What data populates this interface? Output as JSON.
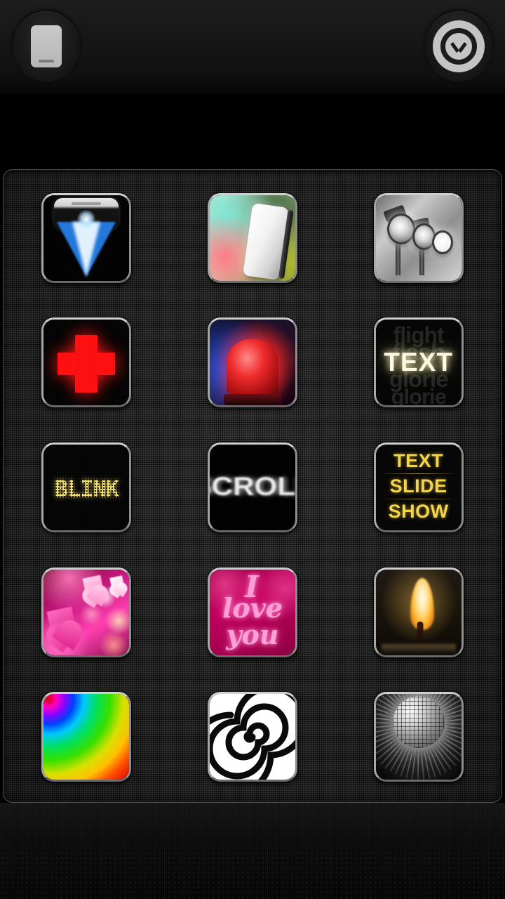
{
  "app": {
    "background_color": "#000000",
    "panel_color": "#272727"
  },
  "topbar": {
    "left_button": {
      "name": "device-button",
      "icon": "phone-device-icon",
      "label": ""
    },
    "right_button": {
      "name": "collapse-button",
      "icon": "chevron-down-circle-icon",
      "label": ""
    }
  },
  "grid": {
    "columns": 3,
    "rows": 5,
    "tiles": [
      {
        "id": "flashlight",
        "name": "tile-flashlight",
        "label": ""
      },
      {
        "id": "color-light",
        "name": "tile-color-light",
        "label": ""
      },
      {
        "id": "stage-lights",
        "name": "tile-stage-lights",
        "label": ""
      },
      {
        "id": "red-cross",
        "name": "tile-emergency-cross",
        "label": ""
      },
      {
        "id": "police-siren",
        "name": "tile-police-siren",
        "label": ""
      },
      {
        "id": "flash-text",
        "name": "tile-flash-text",
        "label": "TEXT",
        "ghost_lines": [
          "flight",
          "flash",
          "glorie",
          "glorie"
        ]
      },
      {
        "id": "blink",
        "name": "tile-blink",
        "label": "BLINK"
      },
      {
        "id": "scroll",
        "name": "tile-scroll",
        "label": "SCROLL"
      },
      {
        "id": "text-slide-show",
        "name": "tile-text-slide-show",
        "label": "",
        "lines": [
          "TEXT",
          "SLIDE",
          "SHOW"
        ]
      },
      {
        "id": "hearts",
        "name": "tile-hearts",
        "label": ""
      },
      {
        "id": "i-love-you",
        "name": "tile-i-love-you",
        "label": "",
        "lines": [
          "I",
          "love",
          "you"
        ]
      },
      {
        "id": "candle",
        "name": "tile-candle",
        "label": ""
      },
      {
        "id": "rainbow",
        "name": "tile-rainbow",
        "label": ""
      },
      {
        "id": "spiral",
        "name": "tile-spiral",
        "label": ""
      },
      {
        "id": "disco-ball",
        "name": "tile-disco-ball",
        "label": ""
      }
    ]
  },
  "bottom": {
    "texture": "speaker-grille"
  }
}
